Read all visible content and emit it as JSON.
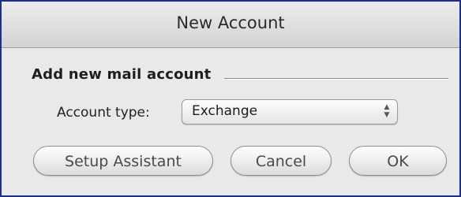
{
  "window": {
    "title": "New Account"
  },
  "section": {
    "label": "Add new mail account"
  },
  "account_type": {
    "label": "Account type:",
    "selected": "Exchange"
  },
  "buttons": {
    "setup_assistant": "Setup Assistant",
    "cancel": "Cancel",
    "ok": "OK"
  },
  "icons": {
    "popup_arrows": "up-down-chevrons-icon"
  },
  "colors": {
    "window_border": "#1b2f8e",
    "background": "#e9e9e9"
  }
}
